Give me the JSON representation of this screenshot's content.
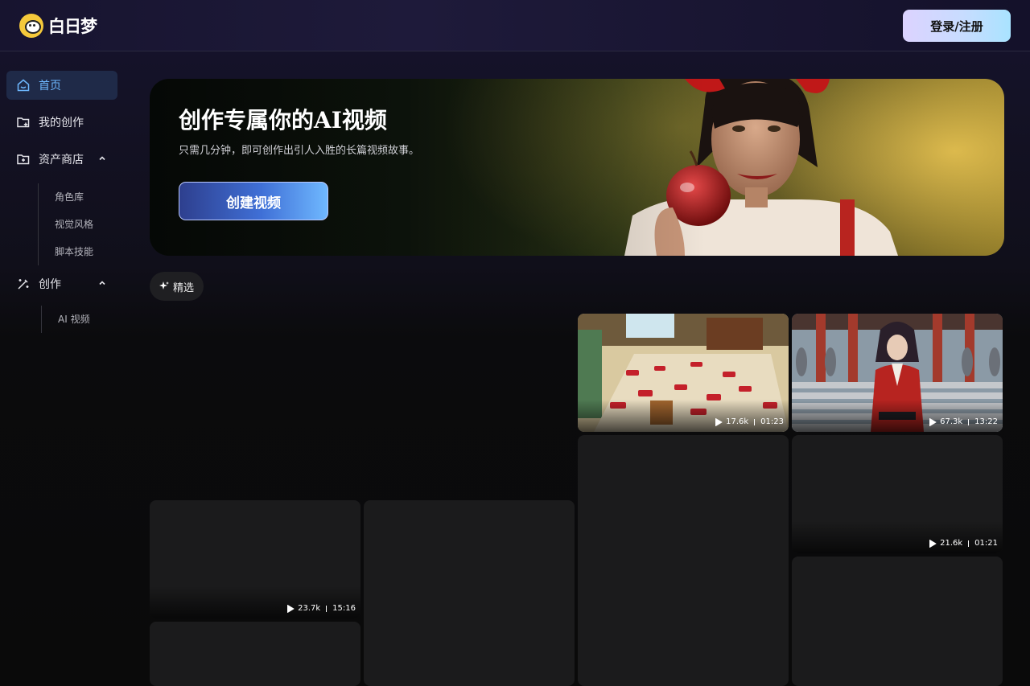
{
  "header": {
    "logo_text": "白日梦",
    "login_label": "登录/注册"
  },
  "sidebar": {
    "items": [
      {
        "label": "首页",
        "icon": "home-icon",
        "active": true
      },
      {
        "label": "我的创作",
        "icon": "folder-add-icon"
      },
      {
        "label": "资产商店",
        "icon": "folder-plus-icon",
        "expanded": true
      },
      {
        "label": "创作",
        "icon": "magic-icon",
        "expanded": true
      }
    ],
    "asset_sub": [
      "角色库",
      "视觉风格",
      "脚本技能"
    ],
    "create_sub": [
      "AI 视频"
    ]
  },
  "banner": {
    "title": "创作专属你的AI视频",
    "subtitle": "只需几分钟，即可创作出引人入胜的长篇视频故事。",
    "button_label": "创建视频"
  },
  "filter": {
    "chip_label": "精选",
    "chip_icon": "sparkle-icon"
  },
  "cards": [
    {
      "views": "17.6k",
      "duration": "01:23"
    },
    {
      "views": "67.3k",
      "duration": "13:22"
    },
    {
      "views": "21.6k",
      "duration": "01:21"
    },
    {
      "views": "23.7k",
      "duration": "15:16"
    }
  ],
  "colors": {
    "accent": "#6eb8ff",
    "active_bg": "#1f2a48",
    "card_bg": "#1b1b1c"
  }
}
